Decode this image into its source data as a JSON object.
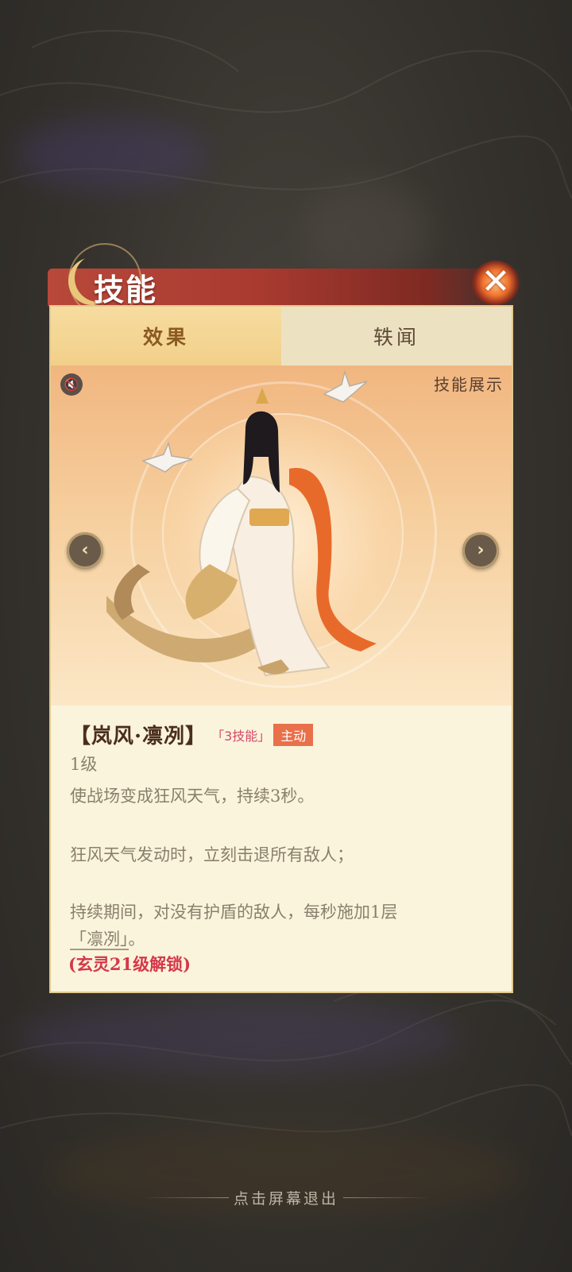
{
  "header": {
    "title": "技能"
  },
  "tabs": [
    {
      "label": "效果",
      "active": true
    },
    {
      "label": "轶闻",
      "active": false
    }
  ],
  "showcase": {
    "label": "技能展示",
    "mute_icon": "mute-icon",
    "prev_icon": "chevron-left-icon",
    "next_icon": "chevron-right-icon"
  },
  "skill": {
    "name": "【岚风·凛冽】",
    "tag": "「3技能」",
    "type": "主动",
    "level": "1级",
    "desc1": "使战场变成狂风天气，持续3秒。",
    "desc2": "狂风天气发动时，立刻击退所有敌人；",
    "desc3": "持续期间，对没有护盾的敌人，每秒施加1层",
    "keyword": "「凛冽」",
    "keyword_suffix": "。",
    "unlock": "(玄灵21级解锁)"
  },
  "footer": {
    "exit_hint": "点击屏幕退出"
  },
  "colors": {
    "accent_red": "#d4384a",
    "tag_pink": "#d4486a",
    "type_orange": "#e8704a",
    "banner_red": "#b8483a",
    "panel_bg": "#fbf4dc"
  }
}
